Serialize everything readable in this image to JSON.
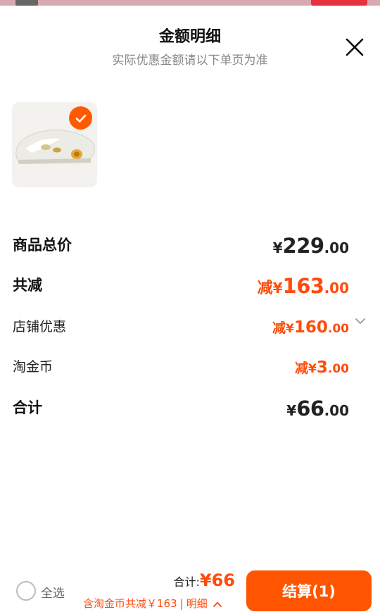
{
  "header": {
    "title": "金额明细",
    "subtitle": "实际优惠金额请以下单页为准"
  },
  "colors": {
    "accent": "#ff5500",
    "price_orange": "#ff4c0b"
  },
  "product": {
    "image_icon": "slide-sandal-image",
    "selected": true
  },
  "rows": {
    "total_price": {
      "label": "商品总价",
      "currency": "¥",
      "integer": "229",
      "decimal": ".00"
    },
    "total_discount": {
      "label": "共减",
      "prefix": "减",
      "currency": "¥",
      "integer": "163",
      "decimal": ".00"
    },
    "shop_discount": {
      "label": "店铺优惠",
      "prefix": "减",
      "currency": "¥",
      "integer": "160",
      "decimal": ".00"
    },
    "taojinbi": {
      "label": "淘金币",
      "prefix": "减",
      "currency": "¥",
      "integer": "3",
      "decimal": ".00"
    },
    "sum": {
      "label": "合计",
      "currency": "¥",
      "integer": "66",
      "decimal": ".00"
    }
  },
  "bottom": {
    "select_all": "全选",
    "total_label": "合计:",
    "total_value": "¥66",
    "note": "含淘金币共减￥163",
    "separator": "|",
    "detail": "明细",
    "checkout": "结算(1)"
  }
}
